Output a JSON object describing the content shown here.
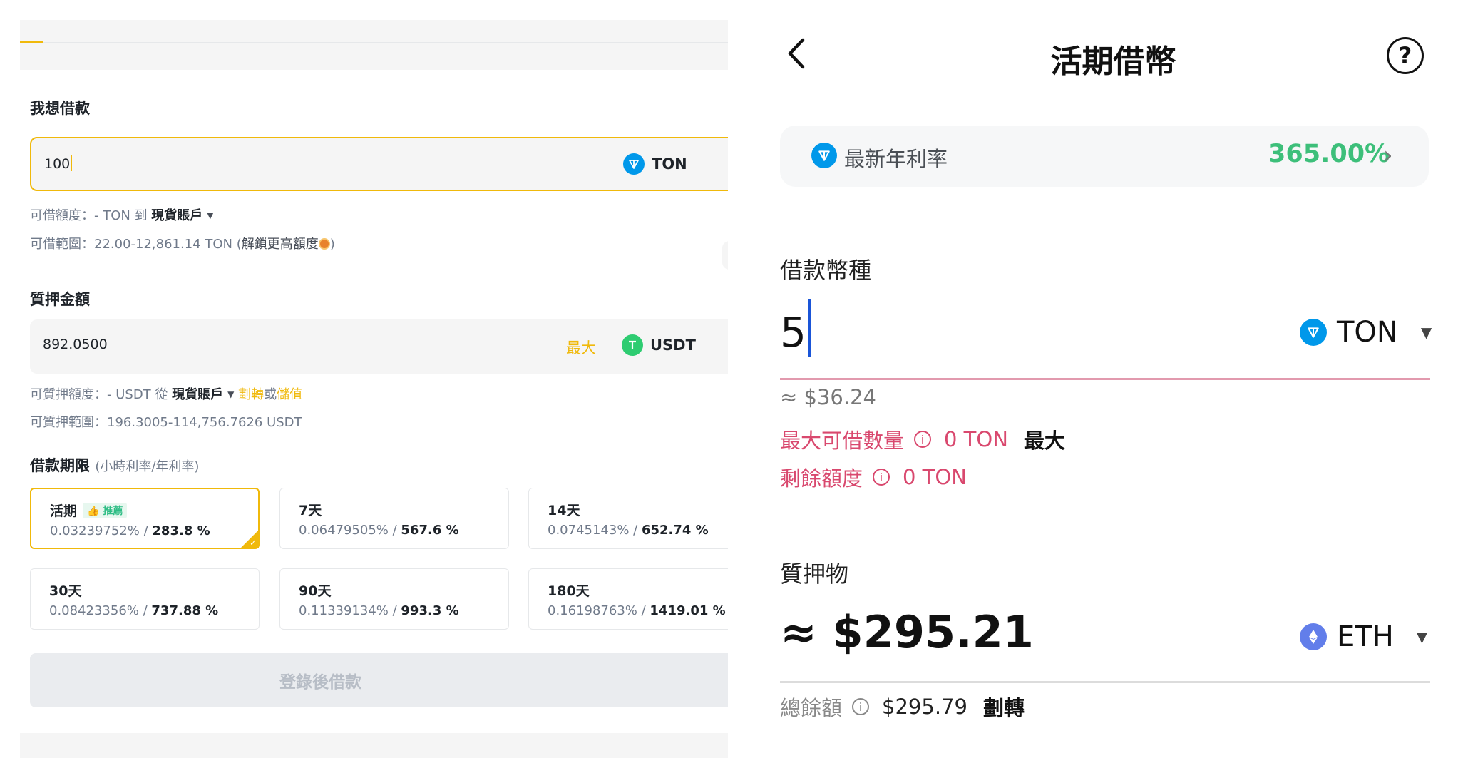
{
  "left": {
    "borrow_label": "我想借款",
    "borrow_value": "100",
    "borrow_coin": "TON",
    "borrowable_label": "可借額度：- TON 到 ",
    "borrowable_account": "現貨賬戶",
    "borrow_range_label": "可借範圍：22.00-12,861.14 TON (",
    "unlock_link": "解鎖更高額度",
    "borrow_range_close": ")",
    "collateral_label": "質押金額",
    "collateral_value": "892.0500",
    "max_label": "最大",
    "collateral_coin": "USDT",
    "pledgeable_label": "可質押額度：- USDT 從 ",
    "pledgeable_account": "現貨賬戶",
    "transfer_link": "劃轉",
    "or_text": "或",
    "deposit_link": "儲值",
    "pledge_range": "可質押範圍：196.3005-114,756.7626 USDT",
    "term_label": "借款期限",
    "term_sublabel": "(小時利率/年利率)",
    "recommended_badge": "👍 推薦",
    "terms": [
      {
        "name": "活期",
        "hourly": "0.03239752% / ",
        "annual": "283.8 %"
      },
      {
        "name": "7天",
        "hourly": "0.06479505% / ",
        "annual": "567.6 %"
      },
      {
        "name": "14天",
        "hourly": "0.0745143% / ",
        "annual": "652.74 %"
      },
      {
        "name": "30天",
        "hourly": "0.08423356% / ",
        "annual": "737.88 %"
      },
      {
        "name": "90天",
        "hourly": "0.11339134% / ",
        "annual": "993.3 %"
      },
      {
        "name": "180天",
        "hourly": "0.16198763% / ",
        "annual": "1419.01 %"
      }
    ],
    "login_button": "登錄後借款"
  },
  "right": {
    "title": "活期借幣",
    "rate_label": "最新年利率",
    "rate_value": "365.00%",
    "borrow_coin_label": "借款幣種",
    "amount": "5",
    "borrow_coin": "TON",
    "approx_usd": "≈ $36.24",
    "max_borrow_label": "最大可借數量",
    "max_borrow_value": "0 TON",
    "max_button": "最大",
    "remaining_label": "剩餘額度",
    "remaining_value": "0 TON",
    "collateral_label": "質押物",
    "collateral_value": "≈ $295.21",
    "collateral_coin": "ETH",
    "balance_label": "總餘額",
    "balance_value": "$295.79",
    "transfer_button": "劃轉"
  },
  "colors": {
    "accent": "#f0b90b",
    "ton": "#0098ea",
    "usdt": "#26a17b",
    "eth": "#627eea",
    "rate_green": "#3dbf7a",
    "pink": "#d9486e"
  }
}
